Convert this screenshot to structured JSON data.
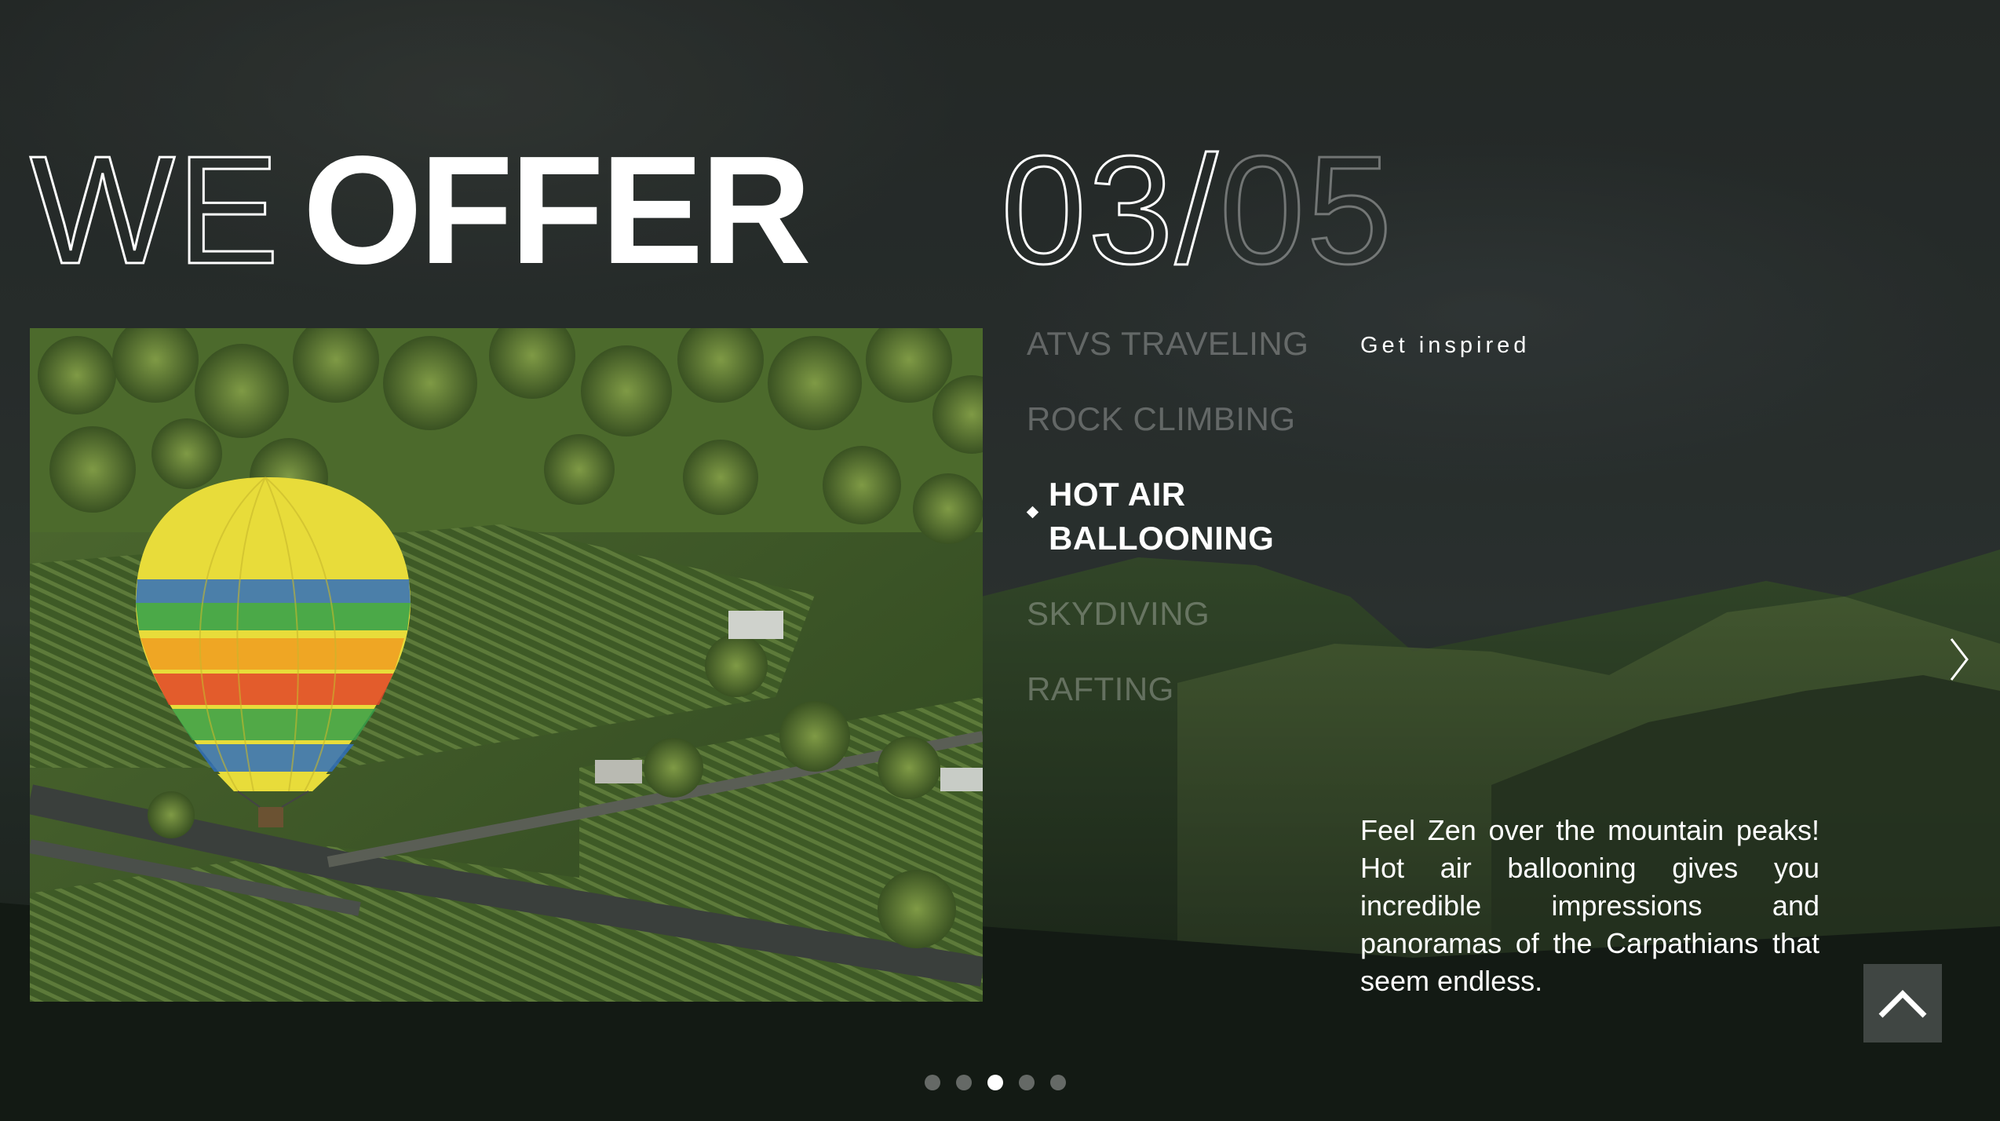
{
  "heading": {
    "light": "WE",
    "bold": "OFFER"
  },
  "counter": {
    "current": "03",
    "separator": "/",
    "total": "05"
  },
  "menu": {
    "items": [
      {
        "label": "ATVS TRAVELING",
        "active": false
      },
      {
        "label": "ROCK CLIMBING",
        "active": false
      },
      {
        "label": "HOT AIR BALLOONING",
        "active": true
      },
      {
        "label": "SKYDIVING",
        "active": false
      },
      {
        "label": "RAFTING",
        "active": false
      }
    ]
  },
  "inspired_link": "Get inspired",
  "description": "Feel Zen over the mountain peaks! Hot air ballooning gives you incredible impressions and panoramas of the Carpathians that seem endless.",
  "pagination": {
    "count": 5,
    "active_index": 2
  },
  "icons": {
    "next": "chevron-right-icon",
    "scroll_top": "chevron-up-icon",
    "active_marker": "diamond-icon"
  },
  "colors": {
    "text": "#ffffff",
    "inactive_text": "rgba(255,255,255,0.28)",
    "background": "#1c2420"
  }
}
